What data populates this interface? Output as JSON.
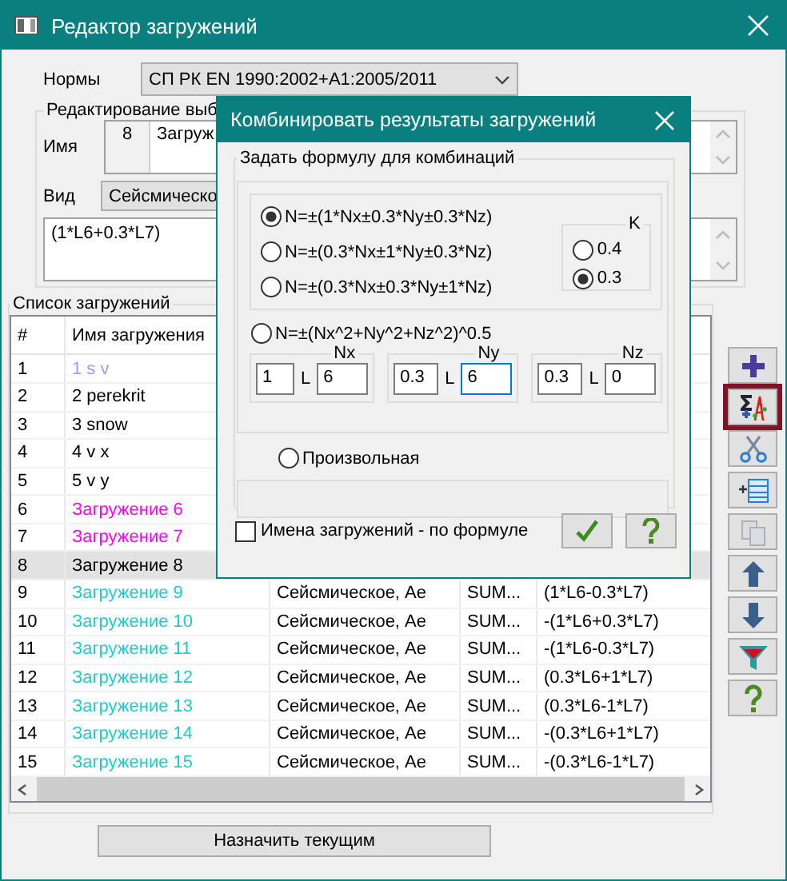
{
  "window": {
    "title": "Редактор загружений"
  },
  "norms": {
    "label": "Нормы",
    "value": "СП РК EN 1990:2002+A1:2005/2011"
  },
  "edit_group": {
    "title": "Редактирование выб",
    "name_label": "Имя",
    "number": "8",
    "name_value": "Загруж",
    "kind_label": "Вид",
    "kind_value": "Сейсмическо",
    "formula": "(1*L6+0.3*L7)"
  },
  "load_list": {
    "title": "Список загружений",
    "columns": [
      "#",
      "Имя загружения"
    ],
    "rows": [
      {
        "number": "1",
        "name": "1 s v",
        "color": "#9c9cf4",
        "selected": false
      },
      {
        "number": "2",
        "name": "2 perekrit",
        "color": "#000000",
        "selected": false
      },
      {
        "number": "3",
        "name": "3 snow",
        "color": "#000000",
        "selected": false
      },
      {
        "number": "4",
        "name": "4 v x",
        "color": "#000000",
        "selected": false
      },
      {
        "number": "5",
        "name": "5 v y",
        "color": "#000000",
        "selected": false
      },
      {
        "number": "6",
        "name": "Загружение 6",
        "color": "#ff00ff",
        "selected": false
      },
      {
        "number": "7",
        "name": "Загружение 7",
        "color": "#ff00ff",
        "selected": false
      },
      {
        "number": "8",
        "name": "Загружение 8",
        "color": "#000000",
        "selected": true
      },
      {
        "number": "9",
        "name": "Загружение 9",
        "color": "#1ecccc",
        "selected": false,
        "type": "Сейсмическое, Ae",
        "sum": "SUM...",
        "formula": "(1*L6-0.3*L7)"
      },
      {
        "number": "10",
        "name": "Загружение 10",
        "color": "#1ecccc",
        "selected": false,
        "type": "Сейсмическое, Ae",
        "sum": "SUM...",
        "formula": "-(1*L6+0.3*L7)"
      },
      {
        "number": "11",
        "name": "Загружение 11",
        "color": "#1ecccc",
        "selected": false,
        "type": "Сейсмическое, Ae",
        "sum": "SUM...",
        "formula": "-(1*L6-0.3*L7)"
      },
      {
        "number": "12",
        "name": "Загружение 12",
        "color": "#1ecccc",
        "selected": false,
        "type": "Сейсмическое, Ae",
        "sum": "SUM...",
        "formula": "(0.3*L6+1*L7)"
      },
      {
        "number": "13",
        "name": "Загружение 13",
        "color": "#1ecccc",
        "selected": false,
        "type": "Сейсмическое, Ae",
        "sum": "SUM...",
        "formula": "(0.3*L6-1*L7)"
      },
      {
        "number": "14",
        "name": "Загружение 14",
        "color": "#1ecccc",
        "selected": false,
        "type": "Сейсмическое, Ae",
        "sum": "SUM...",
        "formula": "-(0.3*L6+1*L7)"
      },
      {
        "number": "15",
        "name": "Загружение 15",
        "color": "#1ecccc",
        "selected": false,
        "type": "Сейсмическое, Ae",
        "sum": "SUM...",
        "formula": "-(0.3*L6-1*L7)"
      }
    ]
  },
  "assign_button": "Назначить текущим",
  "toolbar": [
    {
      "kind": "add",
      "selected": false,
      "disabled": false
    },
    {
      "kind": "combine",
      "selected": true,
      "disabled": false
    },
    {
      "kind": "cut",
      "selected": false,
      "disabled": false
    },
    {
      "kind": "insert",
      "selected": false,
      "disabled": false
    },
    {
      "kind": "copy",
      "selected": false,
      "disabled": true
    },
    {
      "kind": "up",
      "selected": false,
      "disabled": false
    },
    {
      "kind": "down",
      "selected": false,
      "disabled": false
    },
    {
      "kind": "filter",
      "selected": false,
      "disabled": false
    },
    {
      "kind": "help",
      "selected": false,
      "disabled": false
    }
  ],
  "dialog": {
    "title": "Комбинировать результаты загружений",
    "group_title": "Задать формулу для комбинаций",
    "formulas": [
      {
        "label": "N=±(1*Nx±0.3*Ny±0.3*Nz)",
        "selected": true
      },
      {
        "label": "N=±(0.3*Nx±1*Ny±0.3*Nz)",
        "selected": false
      },
      {
        "label": "N=±(0.3*Nx±0.3*Ny±1*Nz)",
        "selected": false
      }
    ],
    "k": {
      "title": "K",
      "options": [
        {
          "label": "0.4",
          "selected": false
        },
        {
          "label": "0.3",
          "selected": true
        }
      ]
    },
    "srss": {
      "label": "N=±(Nx^2+Ny^2+Nz^2)^0.5",
      "selected": false
    },
    "components": [
      {
        "title": "Nx",
        "factor": "1",
        "l_label": "L",
        "load": "6",
        "focused": false
      },
      {
        "title": "Ny",
        "factor": "0.3",
        "l_label": "L",
        "load": "6",
        "focused": true
      },
      {
        "title": "Nz",
        "factor": "0.3",
        "l_label": "L",
        "load": "0",
        "focused": false
      }
    ],
    "custom": {
      "label": "Произвольная",
      "selected": false
    },
    "names_by_formula": {
      "label": "Имена загружений -  по формуле",
      "checked": false
    }
  }
}
